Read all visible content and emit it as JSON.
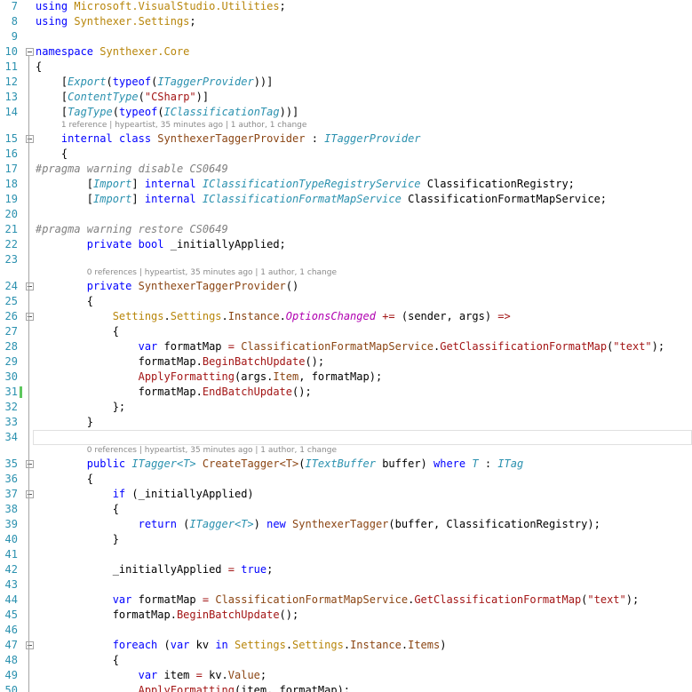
{
  "colors": {
    "keyword": "#0000ff",
    "type": "#2b91af",
    "interface": "#2b91af",
    "namespace": "#b8860b",
    "member": "#8b4513",
    "method": "#a31515",
    "string": "#a31515",
    "attribute": "#2b91af",
    "directive": "#808080",
    "eventname": "#b000b0",
    "plain": "#000000",
    "line_number": "#2b91af",
    "change_marker": "#5ec85e"
  },
  "editor": {
    "rows": [
      {
        "kind": "code",
        "ln": "7",
        "indent": 0,
        "tokens": [
          [
            "keyword",
            "using"
          ],
          [
            "plain",
            " "
          ],
          [
            "namespace",
            "Microsoft.VisualStudio.Utilities"
          ],
          [
            "plain",
            ";"
          ]
        ]
      },
      {
        "kind": "code",
        "ln": "8",
        "indent": 0,
        "tokens": [
          [
            "keyword",
            "using"
          ],
          [
            "plain",
            " "
          ],
          [
            "namespace",
            "Synthexer.Settings"
          ],
          [
            "plain",
            ";"
          ]
        ]
      },
      {
        "kind": "code",
        "ln": "9",
        "indent": 0,
        "tokens": []
      },
      {
        "kind": "code",
        "ln": "10",
        "indent": 0,
        "fold": true,
        "tokens": [
          [
            "keyword",
            "namespace"
          ],
          [
            "plain",
            " "
          ],
          [
            "namespace",
            "Synthexer.Core"
          ]
        ]
      },
      {
        "kind": "code",
        "ln": "11",
        "indent": 0,
        "tokens": [
          [
            "plain",
            "{"
          ]
        ]
      },
      {
        "kind": "code",
        "ln": "12",
        "indent": 4,
        "tokens": [
          [
            "plain",
            "["
          ],
          [
            "type",
            "Export"
          ],
          [
            "plain",
            "("
          ],
          [
            "keyword",
            "typeof"
          ],
          [
            "plain",
            "("
          ],
          [
            "type",
            "ITaggerProvider"
          ],
          [
            "plain",
            "))]"
          ]
        ]
      },
      {
        "kind": "code",
        "ln": "13",
        "indent": 4,
        "tokens": [
          [
            "plain",
            "["
          ],
          [
            "type",
            "ContentType"
          ],
          [
            "plain",
            "("
          ],
          [
            "string",
            "\"CSharp\""
          ],
          [
            "plain",
            ")]"
          ]
        ]
      },
      {
        "kind": "code",
        "ln": "14",
        "indent": 4,
        "tokens": [
          [
            "plain",
            "["
          ],
          [
            "type",
            "TagType"
          ],
          [
            "plain",
            "("
          ],
          [
            "keyword",
            "typeof"
          ],
          [
            "plain",
            "("
          ],
          [
            "type",
            "IClassificationTag"
          ],
          [
            "plain",
            "))]"
          ]
        ]
      },
      {
        "kind": "lens",
        "indent": 4,
        "text": "1 reference | hypeartist, 35 minutes ago | 1 author, 1 change"
      },
      {
        "kind": "code",
        "ln": "15",
        "indent": 4,
        "fold": true,
        "tokens": [
          [
            "keyword",
            "internal"
          ],
          [
            "plain",
            " "
          ],
          [
            "keyword",
            "class"
          ],
          [
            "plain",
            " "
          ],
          [
            "member",
            "SynthexerTaggerProvider"
          ],
          [
            "plain",
            " : "
          ],
          [
            "type",
            "ITaggerProvider"
          ]
        ]
      },
      {
        "kind": "code",
        "ln": "16",
        "indent": 4,
        "tokens": [
          [
            "plain",
            "{"
          ]
        ]
      },
      {
        "kind": "code",
        "ln": "17",
        "indent": 0,
        "tokens": [
          [
            "directive",
            "#pragma warning disable CS0649"
          ]
        ]
      },
      {
        "kind": "code",
        "ln": "18",
        "indent": 8,
        "tokens": [
          [
            "plain",
            "["
          ],
          [
            "type",
            "Import"
          ],
          [
            "plain",
            "] "
          ],
          [
            "keyword",
            "internal"
          ],
          [
            "plain",
            " "
          ],
          [
            "type",
            "IClassificationTypeRegistryService"
          ],
          [
            "plain",
            " ClassificationRegistry;"
          ]
        ]
      },
      {
        "kind": "code",
        "ln": "19",
        "indent": 8,
        "tokens": [
          [
            "plain",
            "["
          ],
          [
            "type",
            "Import"
          ],
          [
            "plain",
            "] "
          ],
          [
            "keyword",
            "internal"
          ],
          [
            "plain",
            " "
          ],
          [
            "type",
            "IClassificationFormatMapService"
          ],
          [
            "plain",
            " ClassificationFormatMapService;"
          ]
        ]
      },
      {
        "kind": "code",
        "ln": "20",
        "indent": 0,
        "tokens": []
      },
      {
        "kind": "code",
        "ln": "21",
        "indent": 0,
        "tokens": [
          [
            "directive",
            "#pragma warning restore CS0649"
          ]
        ]
      },
      {
        "kind": "code",
        "ln": "22",
        "indent": 8,
        "tokens": [
          [
            "keyword",
            "private"
          ],
          [
            "plain",
            " "
          ],
          [
            "keyword",
            "bool"
          ],
          [
            "plain",
            " _initiallyApplied;"
          ]
        ]
      },
      {
        "kind": "code",
        "ln": "23",
        "indent": 0,
        "tokens": []
      },
      {
        "kind": "lens",
        "indent": 8,
        "text": "0 references | hypeartist, 35 minutes ago | 1 author, 1 change"
      },
      {
        "kind": "code",
        "ln": "24",
        "indent": 8,
        "fold": true,
        "tokens": [
          [
            "keyword",
            "private"
          ],
          [
            "plain",
            " "
          ],
          [
            "member",
            "SynthexerTaggerProvider"
          ],
          [
            "plain",
            "()"
          ]
        ]
      },
      {
        "kind": "code",
        "ln": "25",
        "indent": 8,
        "tokens": [
          [
            "plain",
            "{"
          ]
        ]
      },
      {
        "kind": "code",
        "ln": "26",
        "indent": 12,
        "fold": true,
        "tokens": [
          [
            "namespace",
            "Settings"
          ],
          [
            "plain",
            "."
          ],
          [
            "namespace",
            "Settings"
          ],
          [
            "plain",
            "."
          ],
          [
            "member",
            "Instance"
          ],
          [
            "plain",
            "."
          ],
          [
            "eventname",
            "OptionsChanged"
          ],
          [
            "plain",
            " "
          ],
          [
            "method",
            "+="
          ],
          [
            "plain",
            " ("
          ],
          [
            "plain",
            "sender"
          ],
          [
            "plain",
            ", "
          ],
          [
            "plain",
            "args"
          ],
          [
            "plain",
            ") "
          ],
          [
            "method",
            "=>"
          ]
        ]
      },
      {
        "kind": "code",
        "ln": "27",
        "indent": 12,
        "tokens": [
          [
            "plain",
            "{"
          ]
        ]
      },
      {
        "kind": "code",
        "ln": "28",
        "indent": 16,
        "tokens": [
          [
            "keyword",
            "var"
          ],
          [
            "plain",
            " formatMap "
          ],
          [
            "method",
            "="
          ],
          [
            "plain",
            " "
          ],
          [
            "member",
            "ClassificationFormatMapService"
          ],
          [
            "plain",
            "."
          ],
          [
            "method",
            "GetClassificationFormatMap"
          ],
          [
            "plain",
            "("
          ],
          [
            "string",
            "\"text\""
          ],
          [
            "plain",
            ");"
          ]
        ]
      },
      {
        "kind": "code",
        "ln": "29",
        "indent": 16,
        "tokens": [
          [
            "plain",
            "formatMap."
          ],
          [
            "method",
            "BeginBatchUpdate"
          ],
          [
            "plain",
            "();"
          ]
        ]
      },
      {
        "kind": "code",
        "ln": "30",
        "indent": 16,
        "tokens": [
          [
            "method",
            "ApplyFormatting"
          ],
          [
            "plain",
            "("
          ],
          [
            "plain",
            "args"
          ],
          [
            "plain",
            "."
          ],
          [
            "member",
            "Item"
          ],
          [
            "plain",
            ", formatMap);"
          ]
        ]
      },
      {
        "kind": "code",
        "ln": "31",
        "indent": 16,
        "changed": true,
        "tokens": [
          [
            "plain",
            "formatMap."
          ],
          [
            "method",
            "EndBatchUpdate"
          ],
          [
            "plain",
            "();"
          ]
        ]
      },
      {
        "kind": "code",
        "ln": "32",
        "indent": 12,
        "tokens": [
          [
            "plain",
            "};"
          ]
        ]
      },
      {
        "kind": "code",
        "ln": "33",
        "indent": 8,
        "tokens": [
          [
            "plain",
            "}"
          ]
        ]
      },
      {
        "kind": "code",
        "ln": "34",
        "indent": 0,
        "cursor": true,
        "tokens": []
      },
      {
        "kind": "lens",
        "indent": 8,
        "text": "0 references | hypeartist, 35 minutes ago | 1 author, 1 change"
      },
      {
        "kind": "code",
        "ln": "35",
        "indent": 8,
        "fold": true,
        "tokens": [
          [
            "keyword",
            "public"
          ],
          [
            "plain",
            " "
          ],
          [
            "type",
            "ITagger<T>"
          ],
          [
            "plain",
            " "
          ],
          [
            "member",
            "CreateTagger<T>"
          ],
          [
            "plain",
            "("
          ],
          [
            "type",
            "ITextBuffer"
          ],
          [
            "plain",
            " buffer) "
          ],
          [
            "keyword",
            "where"
          ],
          [
            "plain",
            " "
          ],
          [
            "type",
            "T"
          ],
          [
            "plain",
            " : "
          ],
          [
            "type",
            "ITag"
          ]
        ]
      },
      {
        "kind": "code",
        "ln": "36",
        "indent": 8,
        "tokens": [
          [
            "plain",
            "{"
          ]
        ]
      },
      {
        "kind": "code",
        "ln": "37",
        "indent": 12,
        "fold": true,
        "tokens": [
          [
            "keyword",
            "if"
          ],
          [
            "plain",
            " (_initiallyApplied)"
          ]
        ]
      },
      {
        "kind": "code",
        "ln": "38",
        "indent": 12,
        "tokens": [
          [
            "plain",
            "{"
          ]
        ]
      },
      {
        "kind": "code",
        "ln": "39",
        "indent": 16,
        "tokens": [
          [
            "keyword",
            "return"
          ],
          [
            "plain",
            " ("
          ],
          [
            "type",
            "ITagger<T>"
          ],
          [
            "plain",
            ") "
          ],
          [
            "keyword",
            "new"
          ],
          [
            "plain",
            " "
          ],
          [
            "member",
            "SynthexerTagger"
          ],
          [
            "plain",
            "(buffer, ClassificationRegistry);"
          ]
        ]
      },
      {
        "kind": "code",
        "ln": "40",
        "indent": 12,
        "tokens": [
          [
            "plain",
            "}"
          ]
        ]
      },
      {
        "kind": "code",
        "ln": "41",
        "indent": 0,
        "tokens": []
      },
      {
        "kind": "code",
        "ln": "42",
        "indent": 12,
        "tokens": [
          [
            "plain",
            "_initiallyApplied "
          ],
          [
            "method",
            "="
          ],
          [
            "plain",
            " "
          ],
          [
            "keyword",
            "true"
          ],
          [
            "plain",
            ";"
          ]
        ]
      },
      {
        "kind": "code",
        "ln": "43",
        "indent": 0,
        "tokens": []
      },
      {
        "kind": "code",
        "ln": "44",
        "indent": 12,
        "tokens": [
          [
            "keyword",
            "var"
          ],
          [
            "plain",
            " formatMap "
          ],
          [
            "method",
            "="
          ],
          [
            "plain",
            " "
          ],
          [
            "member",
            "ClassificationFormatMapService"
          ],
          [
            "plain",
            "."
          ],
          [
            "method",
            "GetClassificationFormatMap"
          ],
          [
            "plain",
            "("
          ],
          [
            "string",
            "\"text\""
          ],
          [
            "plain",
            ");"
          ]
        ]
      },
      {
        "kind": "code",
        "ln": "45",
        "indent": 12,
        "tokens": [
          [
            "plain",
            "formatMap."
          ],
          [
            "method",
            "BeginBatchUpdate"
          ],
          [
            "plain",
            "();"
          ]
        ]
      },
      {
        "kind": "code",
        "ln": "46",
        "indent": 0,
        "tokens": []
      },
      {
        "kind": "code",
        "ln": "47",
        "indent": 12,
        "fold": true,
        "tokens": [
          [
            "keyword",
            "foreach"
          ],
          [
            "plain",
            " ("
          ],
          [
            "keyword",
            "var"
          ],
          [
            "plain",
            " kv "
          ],
          [
            "keyword",
            "in"
          ],
          [
            "plain",
            " "
          ],
          [
            "namespace",
            "Settings"
          ],
          [
            "plain",
            "."
          ],
          [
            "namespace",
            "Settings"
          ],
          [
            "plain",
            "."
          ],
          [
            "member",
            "Instance"
          ],
          [
            "plain",
            "."
          ],
          [
            "member",
            "Items"
          ],
          [
            "plain",
            ")"
          ]
        ]
      },
      {
        "kind": "code",
        "ln": "48",
        "indent": 12,
        "tokens": [
          [
            "plain",
            "{"
          ]
        ]
      },
      {
        "kind": "code",
        "ln": "49",
        "indent": 16,
        "tokens": [
          [
            "keyword",
            "var"
          ],
          [
            "plain",
            " item "
          ],
          [
            "method",
            "="
          ],
          [
            "plain",
            " kv."
          ],
          [
            "member",
            "Value"
          ],
          [
            "plain",
            ";"
          ]
        ]
      },
      {
        "kind": "code",
        "ln": "50",
        "indent": 16,
        "tokens": [
          [
            "method",
            "ApplyFormatting"
          ],
          [
            "plain",
            "(item, formatMap);"
          ]
        ]
      }
    ]
  }
}
